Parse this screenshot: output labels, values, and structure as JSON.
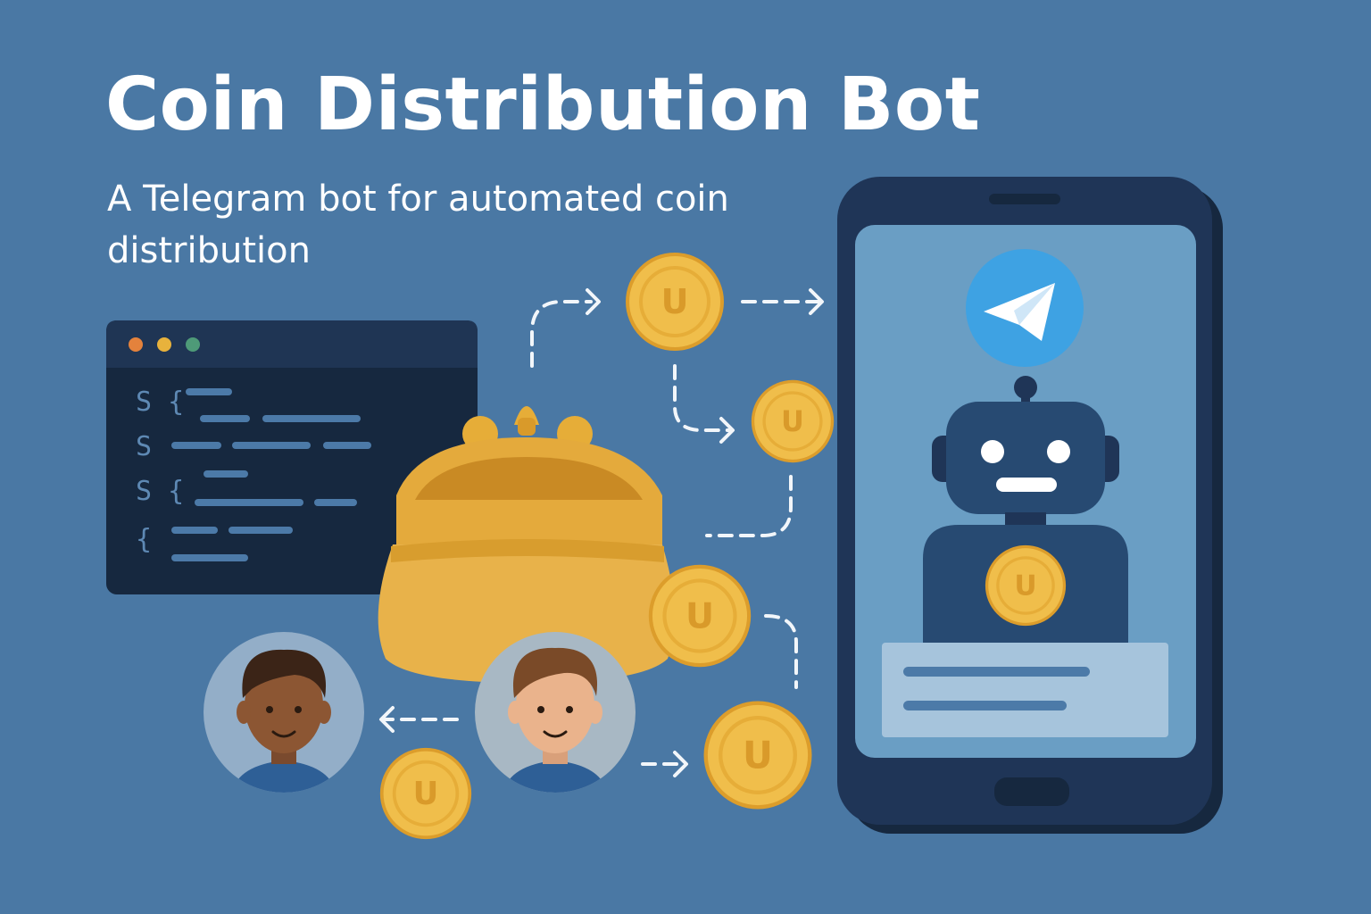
{
  "title": "Coin Distribution Bot",
  "subtitle": "A Telegram bot for automated coin distribution",
  "coin_symbol": "U",
  "code_window": {
    "line_prompts": [
      "S {",
      "S",
      "S {",
      "{"
    ]
  },
  "icons": {
    "messenger": "telegram-paper-plane-icon",
    "wallet": "coin-purse-icon",
    "bot": "robot-icon"
  },
  "colors": {
    "background": "#4a78a4",
    "coin": "#f0be4b",
    "coin_rim": "#d99a2a",
    "phone_body": "#1f3557",
    "phone_screen": "#6a9ec4",
    "telegram": "#3ea2e3",
    "code_bg": "#16283f"
  }
}
